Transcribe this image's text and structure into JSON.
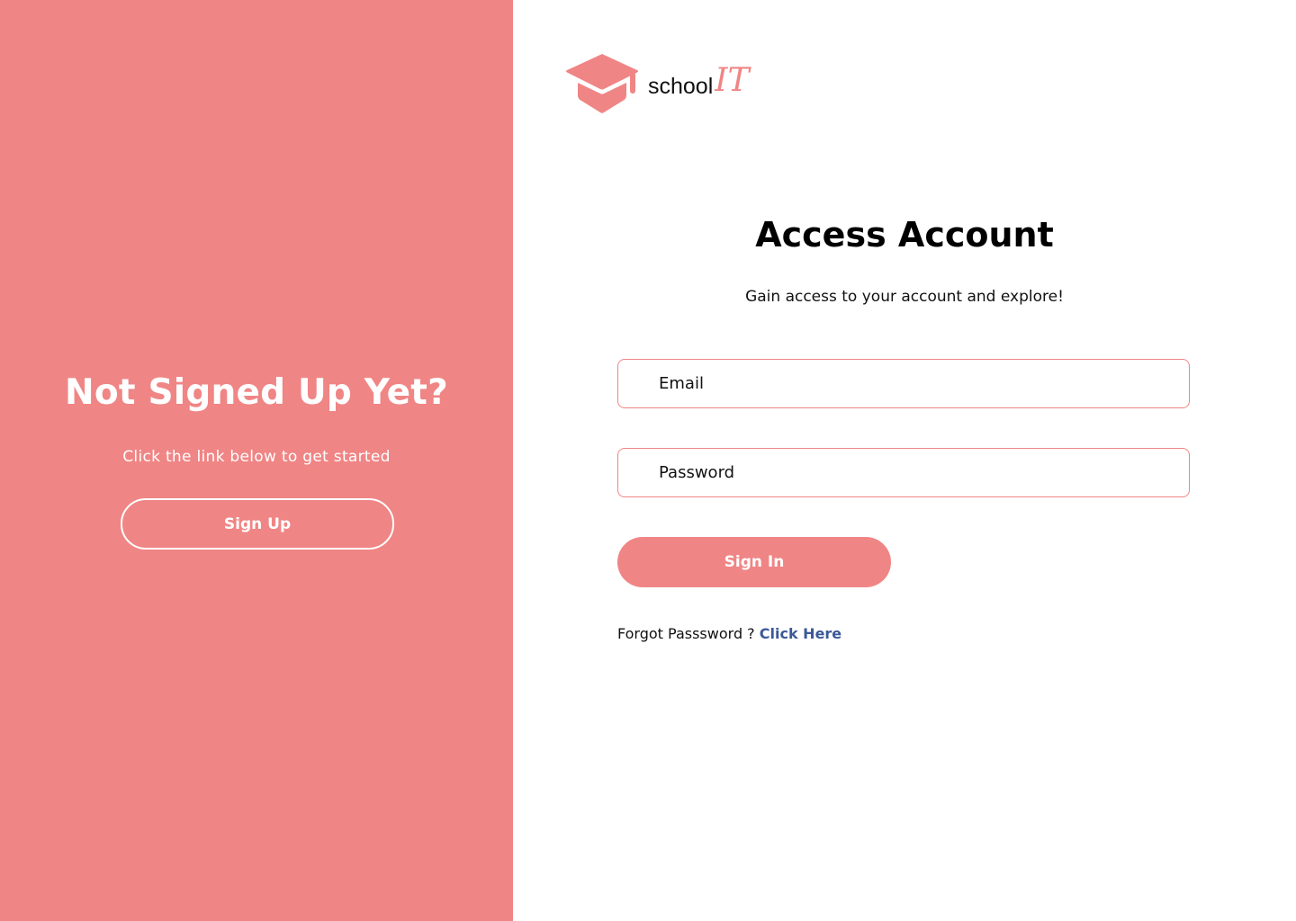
{
  "brand": {
    "name_part1": "school",
    "name_part2": "IT",
    "accent_color": "#f08585",
    "icon": "graduation-cap-icon"
  },
  "left_panel": {
    "heading": "Not Signed Up Yet?",
    "subtext": "Click the link below to get started",
    "signup_label": "Sign Up",
    "background_color": "#f08585"
  },
  "login": {
    "title": "Access Account",
    "subtitle": "Gain access to your account and explore!",
    "email_placeholder": "Email",
    "password_placeholder": "Password",
    "signin_label": "Sign In",
    "forgot_prefix": "Forgot Passsword ?",
    "forgot_link": "Click Here",
    "link_color": "#3b5998"
  }
}
